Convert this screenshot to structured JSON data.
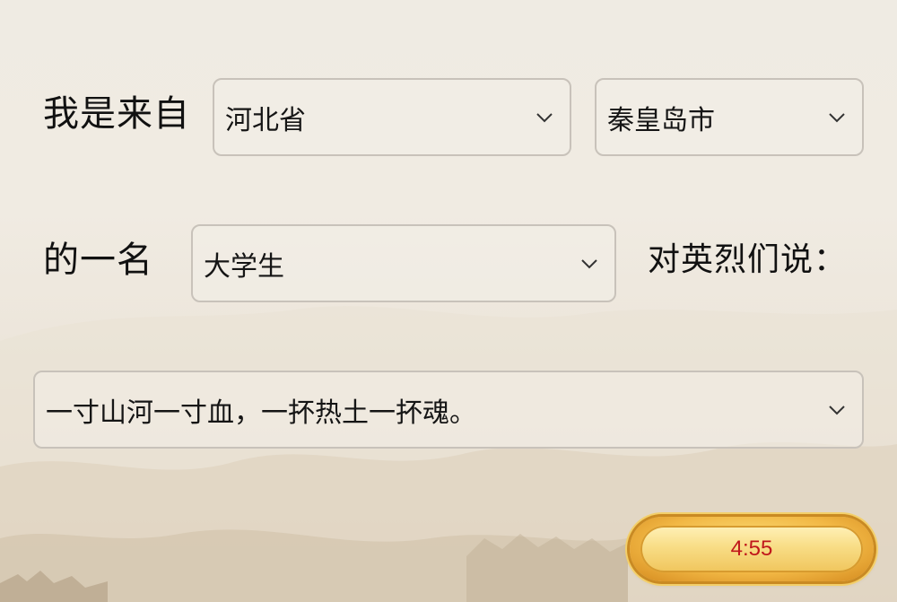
{
  "row1": {
    "prefix": "我是来自",
    "province": "河北省",
    "city": "秦皇岛市"
  },
  "row2": {
    "prefix": "的一名",
    "identity": "大学生",
    "suffix": "对英烈们说："
  },
  "message": {
    "selected": "一寸山河一寸血，一抔热土一抔魂。"
  },
  "timer": {
    "value": "4:55"
  },
  "icons": {
    "dropdown": "chevron-down-icon",
    "background": "great-wall-landscape"
  },
  "colors": {
    "background": "#efebe3",
    "select_border": "#c8c2ba",
    "timer_gold": "#f2b845",
    "timer_text": "#c0171b"
  }
}
